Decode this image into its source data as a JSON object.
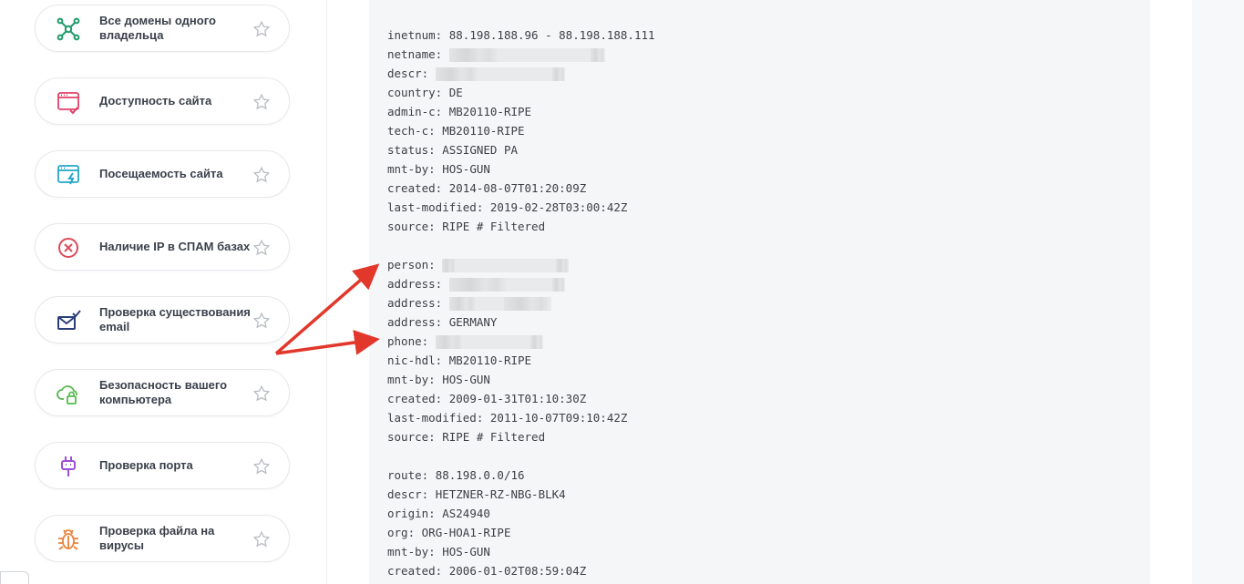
{
  "sidebar": {
    "items": [
      {
        "label": "Все домены одного владельца",
        "icon": "network-nodes-icon",
        "color": "#1f9a6b"
      },
      {
        "label": "Доступность сайта",
        "icon": "browser-check-icon",
        "color": "#e0426a"
      },
      {
        "label": "Посещаемость сайта",
        "icon": "browser-lightning-icon",
        "color": "#22a7c9"
      },
      {
        "label": "Наличие IP в СПАМ базах",
        "icon": "circle-x-icon",
        "color": "#e0495a"
      },
      {
        "label": "Проверка существования email",
        "icon": "envelope-check-icon",
        "color": "#2c3e7a"
      },
      {
        "label": "Безопасность вашего компьютера",
        "icon": "cloud-lock-icon",
        "color": "#56b94e"
      },
      {
        "label": "Проверка порта",
        "icon": "plug-icon",
        "color": "#9b4fd6"
      },
      {
        "label": "Проверка файла на вирусы",
        "icon": "bug-icon",
        "color": "#e8823a"
      }
    ]
  },
  "whois": {
    "block1": [
      {
        "key": "inetnum:",
        "value": "88.198.188.96 - 88.198.188.111"
      },
      {
        "key": "netname:",
        "value": "",
        "redacted": true
      },
      {
        "key": "descr:",
        "value": "",
        "redacted": true
      },
      {
        "key": "country:",
        "value": "DE"
      },
      {
        "key": "admin-c:",
        "value": "MB20110-RIPE"
      },
      {
        "key": "tech-c:",
        "value": "MB20110-RIPE"
      },
      {
        "key": "status:",
        "value": "ASSIGNED PA"
      },
      {
        "key": "mnt-by:",
        "value": "HOS-GUN"
      },
      {
        "key": "created:",
        "value": "2014-08-07T01:20:09Z"
      },
      {
        "key": "last-modified:",
        "value": "2019-02-28T03:00:42Z"
      },
      {
        "key": "source:",
        "value": "RIPE # Filtered"
      }
    ],
    "block2": [
      {
        "key": "person:",
        "value": "",
        "redacted": true
      },
      {
        "key": "address:",
        "value": "",
        "redacted": true
      },
      {
        "key": "address:",
        "value": "",
        "redacted": true
      },
      {
        "key": "address:",
        "value": "GERMANY"
      },
      {
        "key": "phone:",
        "value": "",
        "redacted": true
      },
      {
        "key": "nic-hdl:",
        "value": "MB20110-RIPE"
      },
      {
        "key": "mnt-by:",
        "value": "HOS-GUN"
      },
      {
        "key": "created:",
        "value": "2009-01-31T01:10:30Z"
      },
      {
        "key": "last-modified:",
        "value": "2011-10-07T09:10:42Z"
      },
      {
        "key": "source:",
        "value": "RIPE # Filtered"
      }
    ],
    "block3": [
      {
        "key": "route:",
        "value": "88.198.0.0/16"
      },
      {
        "key": "descr:",
        "value": "HETZNER-RZ-NBG-BLK4"
      },
      {
        "key": "origin:",
        "value": "AS24940"
      },
      {
        "key": "org:",
        "value": "ORG-HOA1-RIPE"
      },
      {
        "key": "mnt-by:",
        "value": "HOS-GUN"
      },
      {
        "key": "created:",
        "value": "2006-01-02T08:59:04Z"
      }
    ]
  },
  "annotation": {
    "arrow_color": "#e2372b"
  },
  "colors": {
    "panel_bg": "#f4f6f8",
    "star": "#b8bcc4",
    "text": "#3c3f45"
  }
}
